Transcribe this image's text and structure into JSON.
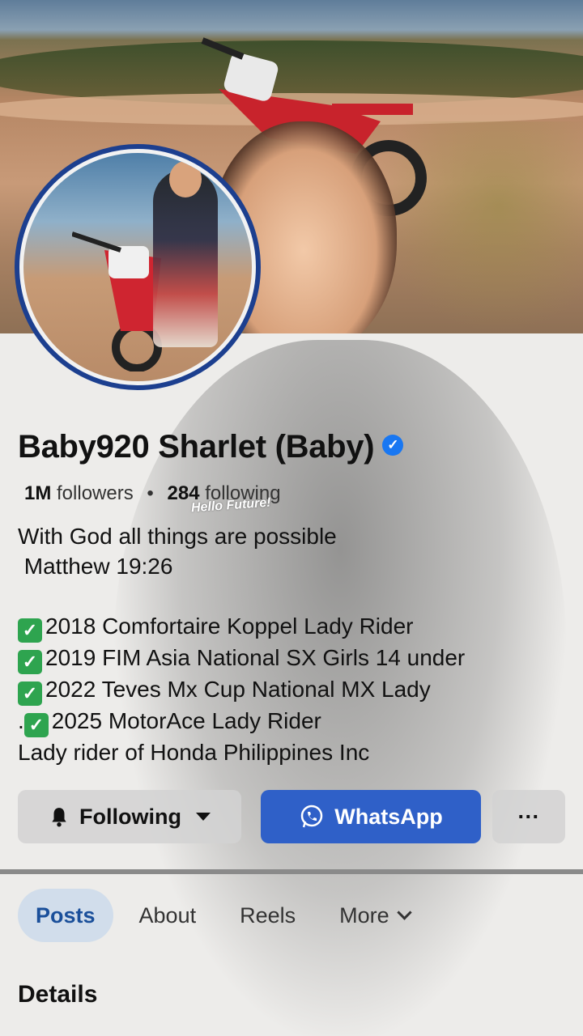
{
  "profile": {
    "name": "Baby920 Sharlet (Baby)",
    "verified": true,
    "followers_count": "1M",
    "followers_label": "followers",
    "following_count": "284",
    "following_label": "following",
    "sticker_text": "Hello Future!"
  },
  "bio": {
    "lines": [
      "With God all things are possible",
      " Matthew 19:26",
      "",
      "2018 Comfortaire Koppel Lady Rider",
      "2019 FIM Asia National SX Girls 14 under",
      "2022 Teves Mx Cup National MX Lady",
      "2025 MotorAce Lady Rider",
      "Lady rider of Honda Philippines Inc"
    ],
    "line7_prefix": "."
  },
  "actions": {
    "following_label": "Following",
    "whatsapp_label": "WhatsApp",
    "more_label": "···"
  },
  "tabs": [
    {
      "label": "Posts",
      "active": true
    },
    {
      "label": "About",
      "active": false
    },
    {
      "label": "Reels",
      "active": false
    },
    {
      "label": "More",
      "active": false
    }
  ],
  "section": {
    "title": "Details"
  },
  "colors": {
    "accent": "#1877f2",
    "whatsapp_button": "#2f60c8",
    "avatar_ring": "#1c3f8f",
    "check": "#2ea44f"
  },
  "icons": [
    "verified-badge-icon",
    "bell-icon",
    "caret-down-icon",
    "whatsapp-icon",
    "ellipsis-icon",
    "check-icon",
    "chevron-down-icon"
  ]
}
